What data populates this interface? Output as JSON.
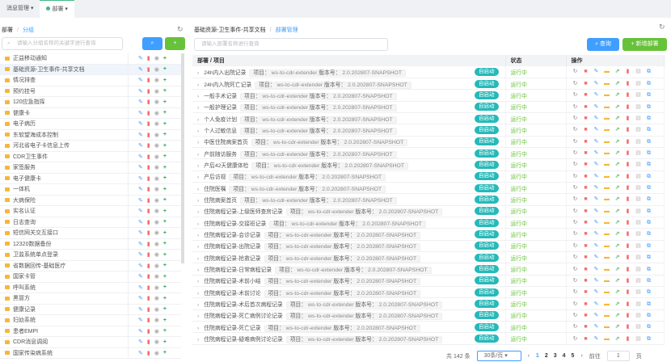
{
  "tabs": [
    {
      "label": "消息管理"
    },
    {
      "label": "部署"
    }
  ],
  "left": {
    "breadcrumb": [
      "部署",
      "分组"
    ],
    "search_placeholder": "请输入分组名称的关键字进行查询",
    "groups": [
      "正益移动通知",
      "基础资源-卫生事件-共享文档",
      "情况排查",
      "预约挂号",
      "120应急指挥",
      "健康卡",
      "电子病历",
      "东软望海成本控制",
      "河北省电子卡信息上传",
      "CDR卫生事件",
      "家签服务",
      "电子健康卡",
      "一体机",
      "大病保险",
      "实名认证",
      "日志查询",
      "短信网关交互接口",
      "12320数据备份",
      "卫监系统单点登录",
      "省数据回传-基础医疗",
      "国家卡管",
      "呼叫系统",
      "黑冒方",
      "健康记录",
      "妇幼系统",
      "患者EMPI",
      "CDR消息调阅",
      "国家传染病系统"
    ],
    "selected_index": 1
  },
  "right": {
    "breadcrumb": [
      "基础资源-卫生事件-共享文档",
      "部署管理"
    ],
    "search_placeholder": "请输入部署名称进行查询",
    "query_label": "查询",
    "add_label": "新增部署",
    "columns": [
      "部署 / 项目",
      "状态",
      "操作"
    ],
    "project_label": "项目：",
    "project": "ws-to-cdr-extender",
    "version_label": "版本号：",
    "version": "2.0.202807-SNAPSHOT",
    "badge": "自启动",
    "status": "运行中",
    "rows": [
      "24h内入出院记录",
      "24h内入院死亡记录",
      "一般手术记录",
      "一般护理记录",
      "个人免疫计划",
      "个人过敏信息",
      "中医住院病案首页",
      "产前随访服务",
      "产后42天健康体检",
      "产后访视",
      "住院医嘱",
      "住院病案首页",
      "住院病程记录-上级医师查房记录",
      "住院病程记录-交接班记录",
      "住院病程记录-会诊记录",
      "住院病程记录-出院记录",
      "住院病程记录-抢救记录",
      "住院病程记录-日常病程记录",
      "住院病程记录-术前小结",
      "住院病程记录-术前讨论",
      "住院病程记录-术后首次病程记录",
      "住院病程记录-死亡病例讨论记录",
      "住院病程记录-死亡记录",
      "住院病程记录-疑难病例讨论记录"
    ]
  },
  "pager": {
    "total": "共 142 条",
    "page_size": "30条/页",
    "pages": [
      "1",
      "2",
      "3",
      "4",
      "5"
    ],
    "current": "1",
    "goto_label": "前往",
    "goto_value": "1",
    "page_suffix": "页"
  }
}
